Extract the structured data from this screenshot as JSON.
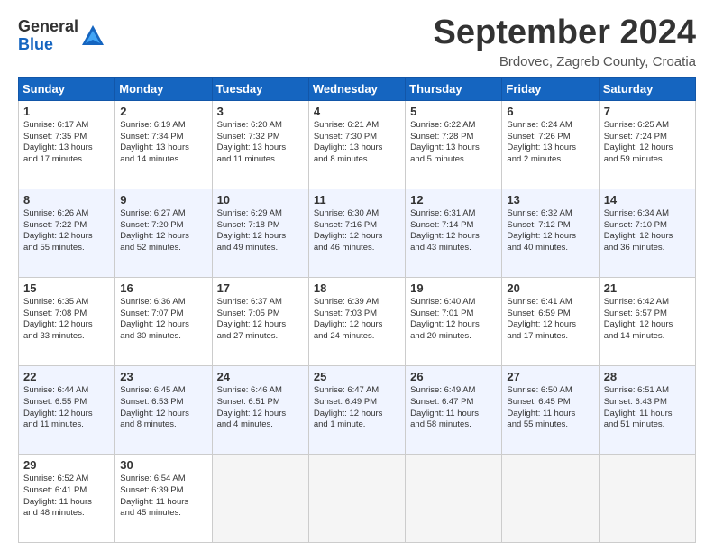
{
  "header": {
    "logo_line1": "General",
    "logo_line2": "Blue",
    "month": "September 2024",
    "location": "Brdovec, Zagreb County, Croatia"
  },
  "weekdays": [
    "Sunday",
    "Monday",
    "Tuesday",
    "Wednesday",
    "Thursday",
    "Friday",
    "Saturday"
  ],
  "weeks": [
    [
      {
        "day": "1",
        "info": "Sunrise: 6:17 AM\nSunset: 7:35 PM\nDaylight: 13 hours\nand 17 minutes."
      },
      {
        "day": "2",
        "info": "Sunrise: 6:19 AM\nSunset: 7:34 PM\nDaylight: 13 hours\nand 14 minutes."
      },
      {
        "day": "3",
        "info": "Sunrise: 6:20 AM\nSunset: 7:32 PM\nDaylight: 13 hours\nand 11 minutes."
      },
      {
        "day": "4",
        "info": "Sunrise: 6:21 AM\nSunset: 7:30 PM\nDaylight: 13 hours\nand 8 minutes."
      },
      {
        "day": "5",
        "info": "Sunrise: 6:22 AM\nSunset: 7:28 PM\nDaylight: 13 hours\nand 5 minutes."
      },
      {
        "day": "6",
        "info": "Sunrise: 6:24 AM\nSunset: 7:26 PM\nDaylight: 13 hours\nand 2 minutes."
      },
      {
        "day": "7",
        "info": "Sunrise: 6:25 AM\nSunset: 7:24 PM\nDaylight: 12 hours\nand 59 minutes."
      }
    ],
    [
      {
        "day": "8",
        "info": "Sunrise: 6:26 AM\nSunset: 7:22 PM\nDaylight: 12 hours\nand 55 minutes."
      },
      {
        "day": "9",
        "info": "Sunrise: 6:27 AM\nSunset: 7:20 PM\nDaylight: 12 hours\nand 52 minutes."
      },
      {
        "day": "10",
        "info": "Sunrise: 6:29 AM\nSunset: 7:18 PM\nDaylight: 12 hours\nand 49 minutes."
      },
      {
        "day": "11",
        "info": "Sunrise: 6:30 AM\nSunset: 7:16 PM\nDaylight: 12 hours\nand 46 minutes."
      },
      {
        "day": "12",
        "info": "Sunrise: 6:31 AM\nSunset: 7:14 PM\nDaylight: 12 hours\nand 43 minutes."
      },
      {
        "day": "13",
        "info": "Sunrise: 6:32 AM\nSunset: 7:12 PM\nDaylight: 12 hours\nand 40 minutes."
      },
      {
        "day": "14",
        "info": "Sunrise: 6:34 AM\nSunset: 7:10 PM\nDaylight: 12 hours\nand 36 minutes."
      }
    ],
    [
      {
        "day": "15",
        "info": "Sunrise: 6:35 AM\nSunset: 7:08 PM\nDaylight: 12 hours\nand 33 minutes."
      },
      {
        "day": "16",
        "info": "Sunrise: 6:36 AM\nSunset: 7:07 PM\nDaylight: 12 hours\nand 30 minutes."
      },
      {
        "day": "17",
        "info": "Sunrise: 6:37 AM\nSunset: 7:05 PM\nDaylight: 12 hours\nand 27 minutes."
      },
      {
        "day": "18",
        "info": "Sunrise: 6:39 AM\nSunset: 7:03 PM\nDaylight: 12 hours\nand 24 minutes."
      },
      {
        "day": "19",
        "info": "Sunrise: 6:40 AM\nSunset: 7:01 PM\nDaylight: 12 hours\nand 20 minutes."
      },
      {
        "day": "20",
        "info": "Sunrise: 6:41 AM\nSunset: 6:59 PM\nDaylight: 12 hours\nand 17 minutes."
      },
      {
        "day": "21",
        "info": "Sunrise: 6:42 AM\nSunset: 6:57 PM\nDaylight: 12 hours\nand 14 minutes."
      }
    ],
    [
      {
        "day": "22",
        "info": "Sunrise: 6:44 AM\nSunset: 6:55 PM\nDaylight: 12 hours\nand 11 minutes."
      },
      {
        "day": "23",
        "info": "Sunrise: 6:45 AM\nSunset: 6:53 PM\nDaylight: 12 hours\nand 8 minutes."
      },
      {
        "day": "24",
        "info": "Sunrise: 6:46 AM\nSunset: 6:51 PM\nDaylight: 12 hours\nand 4 minutes."
      },
      {
        "day": "25",
        "info": "Sunrise: 6:47 AM\nSunset: 6:49 PM\nDaylight: 12 hours\nand 1 minute."
      },
      {
        "day": "26",
        "info": "Sunrise: 6:49 AM\nSunset: 6:47 PM\nDaylight: 11 hours\nand 58 minutes."
      },
      {
        "day": "27",
        "info": "Sunrise: 6:50 AM\nSunset: 6:45 PM\nDaylight: 11 hours\nand 55 minutes."
      },
      {
        "day": "28",
        "info": "Sunrise: 6:51 AM\nSunset: 6:43 PM\nDaylight: 11 hours\nand 51 minutes."
      }
    ],
    [
      {
        "day": "29",
        "info": "Sunrise: 6:52 AM\nSunset: 6:41 PM\nDaylight: 11 hours\nand 48 minutes."
      },
      {
        "day": "30",
        "info": "Sunrise: 6:54 AM\nSunset: 6:39 PM\nDaylight: 11 hours\nand 45 minutes."
      },
      null,
      null,
      null,
      null,
      null
    ]
  ]
}
